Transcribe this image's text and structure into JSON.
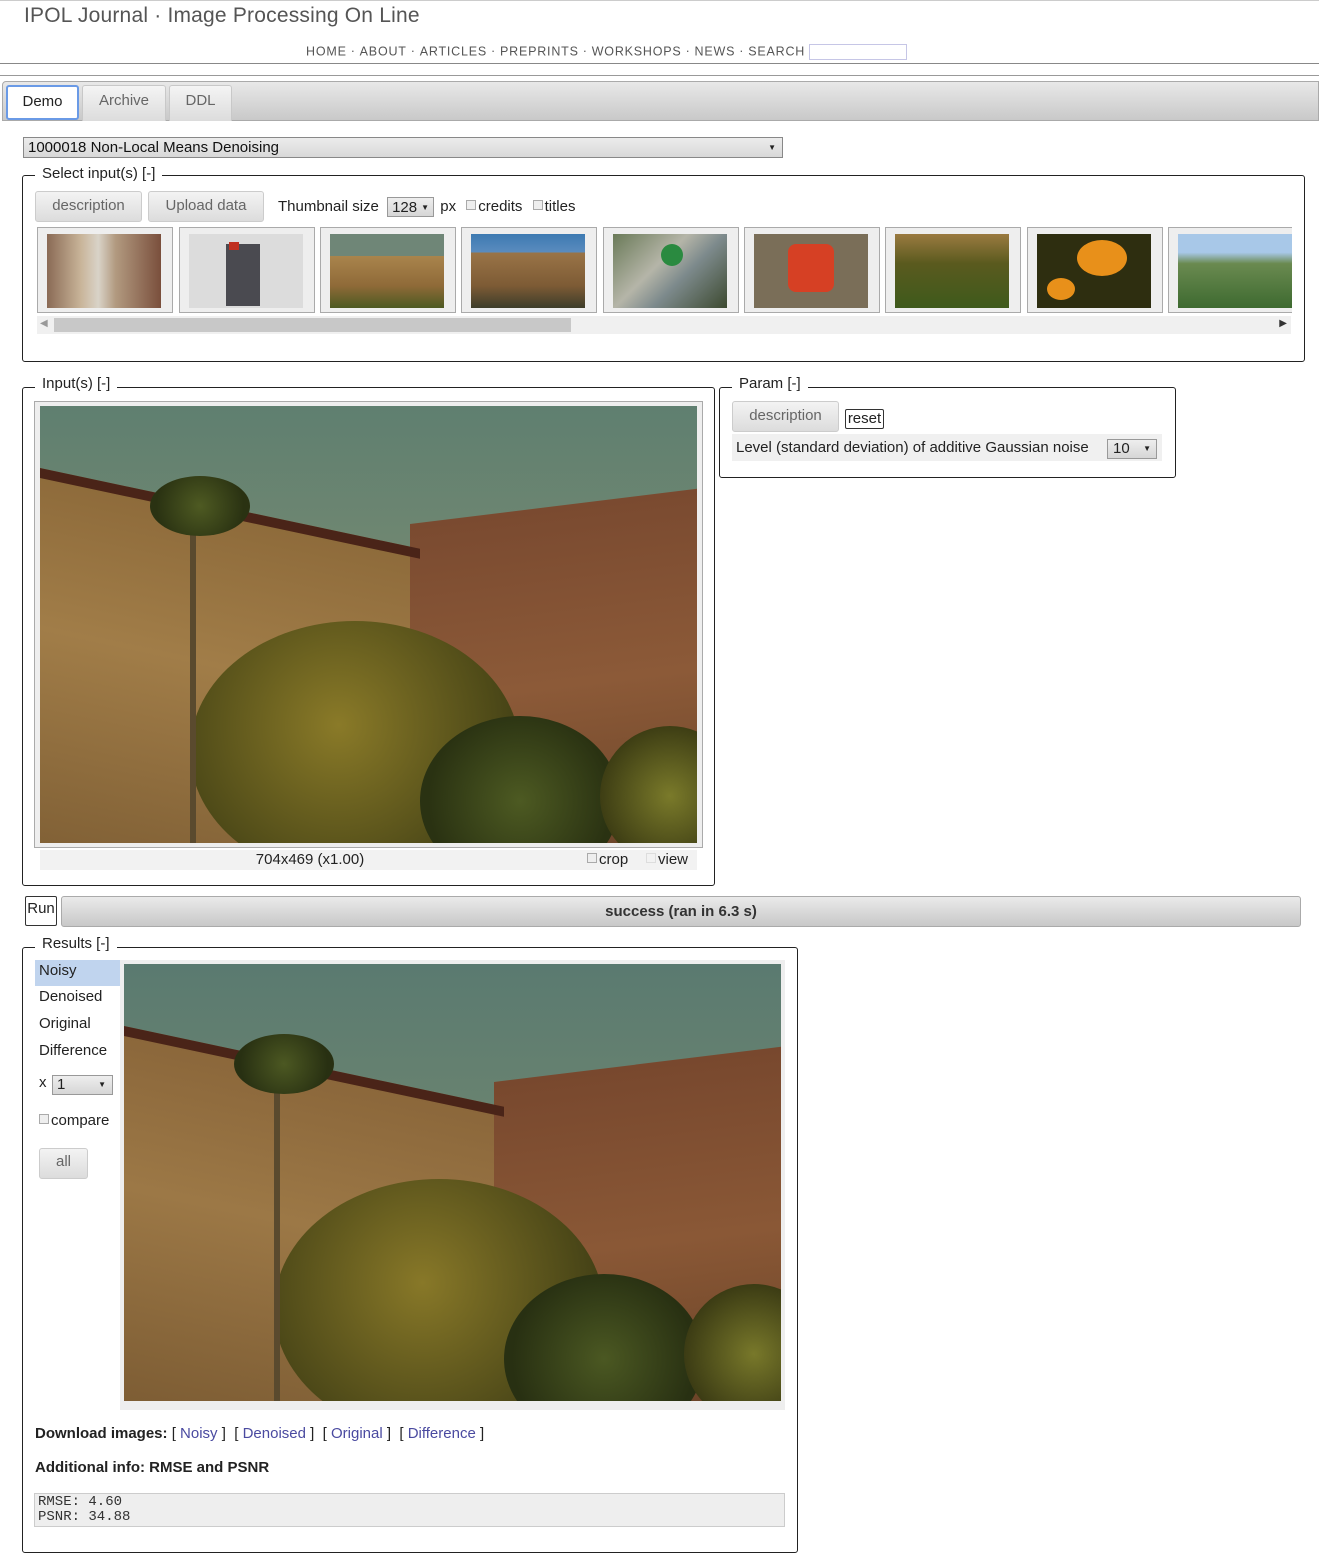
{
  "header": {
    "title": "IPOL Journal · Image Processing On Line",
    "nav": [
      "HOME",
      "ABOUT",
      "ARTICLES",
      "PREPRINTS",
      "WORKSHOPS",
      "NEWS",
      "SEARCH"
    ],
    "search_value": ""
  },
  "tabs": [
    {
      "label": "Demo",
      "active": true
    },
    {
      "label": "Archive",
      "active": false
    },
    {
      "label": "DDL",
      "active": false
    }
  ],
  "demo_select": {
    "value": "1000018 Non-Local Means Denoising"
  },
  "inputs_selector": {
    "legend": "Select input(s) [-]",
    "description_button": "description",
    "upload_button": "Upload data",
    "thumb_label": "Thumbnail size",
    "thumb_size": "128",
    "thumb_unit": "px",
    "credits_label": "credits",
    "titles_label": "titles",
    "thumbnails": [
      "street",
      "book",
      "building-1",
      "building-2",
      "circuit-board",
      "red-die",
      "garden",
      "orange-flowers",
      "park"
    ]
  },
  "inputs_panel": {
    "legend": "Input(s) [-]",
    "image_info": "704x469 (x1.00)",
    "crop_label": "crop",
    "view_label": "view"
  },
  "param_panel": {
    "legend": "Param [-]",
    "description_button": "description",
    "reset_button": "reset",
    "noise_label": "Level (standard deviation) of additive Gaussian noise",
    "noise_value": "10"
  },
  "run": {
    "run_button": "Run",
    "status": "success (ran in 6.3 s)"
  },
  "results": {
    "legend": "Results [-]",
    "items": [
      "Noisy",
      "Denoised",
      "Original",
      "Difference"
    ],
    "selected": "Noisy",
    "zoom_prefix": "x",
    "zoom_value": "1",
    "compare_label": "compare",
    "all_button": "all",
    "download_label": "Download images:",
    "download_links": [
      "Noisy",
      "Denoised",
      "Original",
      "Difference"
    ],
    "info_title": "Additional info: RMSE and PSNR",
    "rmse_line": "RMSE: 4.60",
    "psnr_line": "PSNR: 34.88"
  }
}
